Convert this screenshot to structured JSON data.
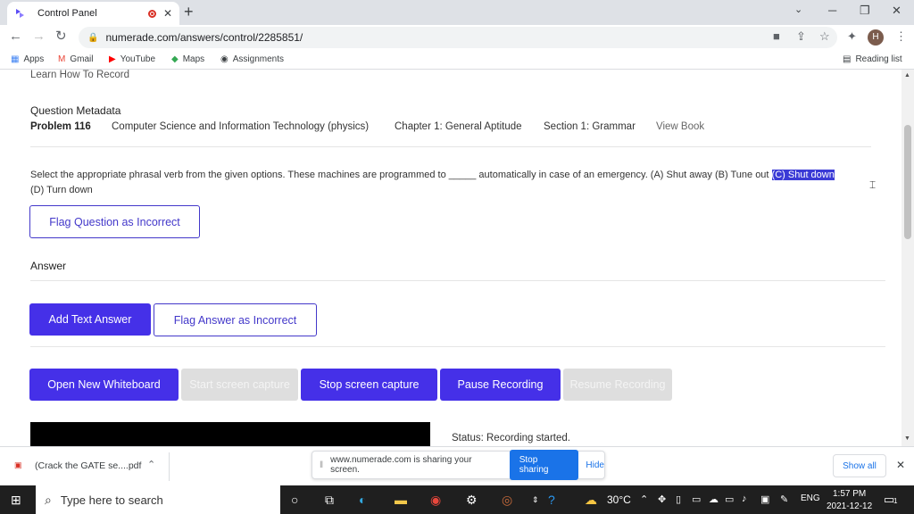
{
  "browser": {
    "tab_title": "Control Panel",
    "url": "numerade.com/answers/control/2285851/",
    "minimize": "─",
    "restore": "❐",
    "close": "✕",
    "new_tab": "+",
    "tab_close": "✕",
    "nav_back": "←",
    "nav_forward": "→",
    "nav_reload": "↻",
    "lock": "🔒"
  },
  "bookmarks": {
    "items": [
      {
        "label": "Apps",
        "icon": "apps-grid-icon"
      },
      {
        "label": "Gmail",
        "icon": "gmail-icon"
      },
      {
        "label": "YouTube",
        "icon": "youtube-icon"
      },
      {
        "label": "Maps",
        "icon": "maps-icon"
      },
      {
        "label": "Assignments",
        "icon": "globe-icon"
      }
    ],
    "reading_list": "Reading list"
  },
  "page": {
    "learn_link": "Learn How To Record",
    "metadata_heading": "Question Metadata",
    "problem": "Problem 116",
    "subject": "Computer Science and Information Technology (physics)",
    "chapter": "Chapter 1: General Aptitude",
    "section": "Section 1: Grammar",
    "view_book": "View Book",
    "question_part1": "Select the appropriate phrasal verb from the given options. These machines are programmed to _____ automatically in case of an emergency. (A) Shut away (B) Tune out ",
    "question_highlight": "(C) Shut down",
    "question_part2": "(D) Turn down",
    "flag_question": "Flag Question as Incorrect",
    "answer_heading": "Answer",
    "add_text_answer": "Add Text Answer",
    "flag_answer": "Flag Answer as Incorrect",
    "open_whiteboard": "Open New Whiteboard",
    "start_capture": "Start screen capture",
    "stop_capture": "Stop screen capture",
    "pause_recording": "Pause Recording",
    "resume_recording": "Resume Recording",
    "status": "Status: Recording started."
  },
  "downloads": {
    "file": "(Crack the GATE se....pdf",
    "share_text": "www.numerade.com is sharing your screen.",
    "stop_sharing": "Stop sharing",
    "hide": "Hide",
    "show_all": "Show all"
  },
  "taskbar": {
    "search_placeholder": "Type here to search",
    "temperature": "30°C",
    "language": "ENG",
    "time": "1:57 PM",
    "date": "2021-12-12",
    "notification_count": "1"
  },
  "colors": {
    "accent": "#4530e8",
    "taskbar": "#1f1f1f"
  }
}
